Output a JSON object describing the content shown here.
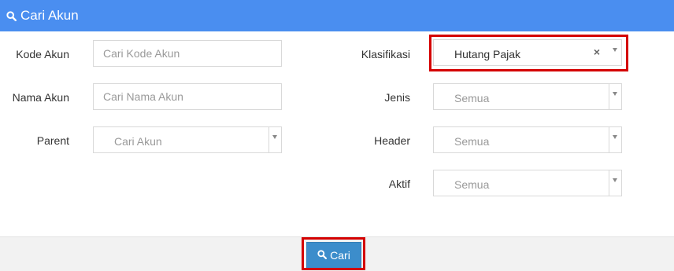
{
  "header": {
    "title": "Cari Akun",
    "icon": "search-icon"
  },
  "form": {
    "kode_akun": {
      "label": "Kode Akun",
      "placeholder": "Cari Kode Akun",
      "value": ""
    },
    "nama_akun": {
      "label": "Nama Akun",
      "placeholder": "Cari Nama Akun",
      "value": ""
    },
    "parent": {
      "label": "Parent",
      "selected": "Cari Akun"
    },
    "klasifikasi": {
      "label": "Klasifikasi",
      "selected": "Hutang Pajak",
      "clear_symbol": "×"
    },
    "jenis": {
      "label": "Jenis",
      "selected": "Semua"
    },
    "header": {
      "label": "Header",
      "selected": "Semua"
    },
    "aktif": {
      "label": "Aktif",
      "selected": "Semua"
    }
  },
  "footer": {
    "submit_label": "Cari"
  },
  "colors": {
    "header_bg": "#4a8ef0",
    "button_bg": "#3c8dcb",
    "highlight": "#d40000"
  }
}
